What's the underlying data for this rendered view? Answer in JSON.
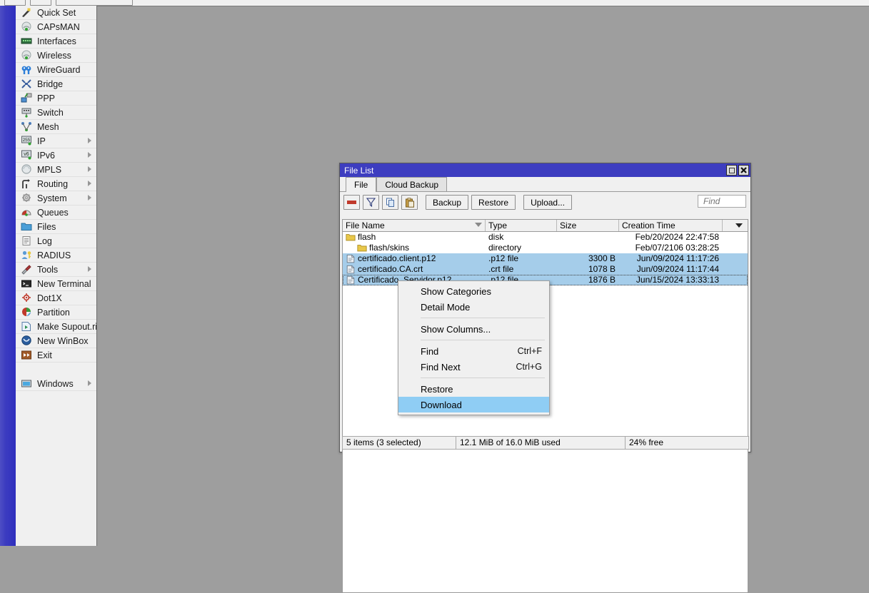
{
  "desktop": {
    "background": "#9e9e9e"
  },
  "top_toolbar": {
    "visible_button_stubs": 3
  },
  "sidebar": {
    "accent_color": "#3c3cc0",
    "background": "#f0f0f0",
    "items": [
      {
        "label": "Quick Set",
        "icon": "wand-icon",
        "submenu": false
      },
      {
        "label": "CAPsMAN",
        "icon": "antenna-icon",
        "submenu": false
      },
      {
        "label": "Interfaces",
        "icon": "network-card-icon",
        "submenu": false
      },
      {
        "label": "Wireless",
        "icon": "antenna-icon",
        "submenu": false
      },
      {
        "label": "WireGuard",
        "icon": "wireguard-icon",
        "submenu": false
      },
      {
        "label": "Bridge",
        "icon": "bridge-icon",
        "submenu": false
      },
      {
        "label": "PPP",
        "icon": "ppp-icon",
        "submenu": false
      },
      {
        "label": "Switch",
        "icon": "switch-icon",
        "submenu": false
      },
      {
        "label": "Mesh",
        "icon": "mesh-icon",
        "submenu": false
      },
      {
        "label": "IP",
        "icon": "ip-255-icon",
        "submenu": true
      },
      {
        "label": "IPv6",
        "icon": "ipv6-icon",
        "submenu": true
      },
      {
        "label": "MPLS",
        "icon": "mpls-icon",
        "submenu": true
      },
      {
        "label": "Routing",
        "icon": "routing-icon",
        "submenu": true
      },
      {
        "label": "System",
        "icon": "gear-icon",
        "submenu": true
      },
      {
        "label": "Queues",
        "icon": "queues-icon",
        "submenu": false
      },
      {
        "label": "Files",
        "icon": "folder-icon",
        "submenu": false
      },
      {
        "label": "Log",
        "icon": "log-icon",
        "submenu": false
      },
      {
        "label": "RADIUS",
        "icon": "radius-user-icon",
        "submenu": false
      },
      {
        "label": "Tools",
        "icon": "tools-icon",
        "submenu": true
      },
      {
        "label": "New Terminal",
        "icon": "terminal-icon",
        "submenu": false
      },
      {
        "label": "Dot1X",
        "icon": "dot1x-icon",
        "submenu": false
      },
      {
        "label": "Partition",
        "icon": "partition-icon",
        "submenu": false
      },
      {
        "label": "Make Supout.rif",
        "icon": "supout-icon",
        "submenu": false
      },
      {
        "label": "New WinBox",
        "icon": "winbox-icon",
        "submenu": false
      },
      {
        "label": "Exit",
        "icon": "exit-icon",
        "submenu": false
      }
    ],
    "footer_items": [
      {
        "label": "Windows",
        "icon": "window-icon",
        "submenu": true
      }
    ]
  },
  "file_list_window": {
    "title": "File List",
    "title_color": "#3d3dc0",
    "buttons": {
      "maximize": "maximize-icon",
      "close": "close-icon"
    },
    "tabs": [
      {
        "label": "File",
        "active": true
      },
      {
        "label": "Cloud Backup",
        "active": false
      }
    ],
    "toolbar": {
      "remove_icon": "minus-icon",
      "filter_icon": "funnel-icon",
      "copy_icon": "copy-icon",
      "paste_icon": "paste-icon",
      "backup_label": "Backup",
      "restore_label": "Restore",
      "upload_label": "Upload...",
      "find_placeholder": "Find",
      "find_value": ""
    },
    "table": {
      "columns": [
        "File Name",
        "Type",
        "Size",
        "Creation Time"
      ],
      "sorted_column": "File Name",
      "rows": [
        {
          "name": "flash",
          "icon": "folder-icon",
          "indent": false,
          "type": "disk",
          "size": "",
          "time": "Feb/20/2024 22:47:58",
          "selected": false,
          "focused": false
        },
        {
          "name": "flash/skins",
          "icon": "folder-icon",
          "indent": true,
          "type": "directory",
          "size": "",
          "time": "Feb/07/2106 03:28:25",
          "selected": false,
          "focused": false
        },
        {
          "name": "certificado.client.p12",
          "icon": "file-icon",
          "indent": false,
          "type": ".p12 file",
          "size": "3300 B",
          "time": "Jun/09/2024 11:17:26",
          "selected": true,
          "focused": false
        },
        {
          "name": "certificado.CA.crt",
          "icon": "file-icon",
          "indent": false,
          "type": ".crt file",
          "size": "1078 B",
          "time": "Jun/09/2024 11:17:44",
          "selected": true,
          "focused": false
        },
        {
          "name": "Certificado_Servidor.p12",
          "icon": "file-icon",
          "indent": false,
          "type": ".p12 file",
          "size": "1876 B",
          "time": "Jun/15/2024 13:33:13",
          "selected": true,
          "focused": true
        }
      ]
    },
    "status_bar": {
      "items_text": "5 items (3 selected)",
      "usage_text": "12.1 MiB of 16.0 MiB used",
      "free_text": "24% free"
    }
  },
  "context_menu": {
    "highlight_color": "#8fcdf4",
    "entries": [
      {
        "label": "Show Categories",
        "accel": "",
        "type": "item",
        "highlighted": false
      },
      {
        "label": "Detail Mode",
        "accel": "",
        "type": "item",
        "highlighted": false
      },
      {
        "label": "",
        "accel": "",
        "type": "separator",
        "highlighted": false
      },
      {
        "label": "Show Columns...",
        "accel": "",
        "type": "item",
        "highlighted": false
      },
      {
        "label": "",
        "accel": "",
        "type": "separator",
        "highlighted": false
      },
      {
        "label": "Find",
        "accel": "Ctrl+F",
        "type": "item",
        "highlighted": false
      },
      {
        "label": "Find Next",
        "accel": "Ctrl+G",
        "type": "item",
        "highlighted": false
      },
      {
        "label": "",
        "accel": "",
        "type": "separator",
        "highlighted": false
      },
      {
        "label": "Restore",
        "accel": "",
        "type": "item",
        "highlighted": false
      },
      {
        "label": "Download",
        "accel": "",
        "type": "item",
        "highlighted": true
      }
    ]
  }
}
